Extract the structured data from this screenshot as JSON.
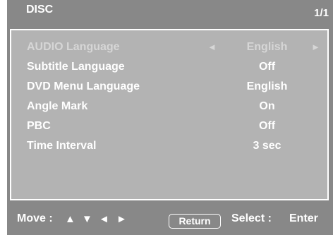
{
  "header": {
    "title": "DISC",
    "page": "1/1"
  },
  "menu": {
    "items": [
      {
        "label": "AUDIO Language",
        "value": "English",
        "selected": true
      },
      {
        "label": "Subtitle Language",
        "value": "Off"
      },
      {
        "label": "DVD Menu Language",
        "value": "English"
      },
      {
        "label": "Angle Mark",
        "value": "On"
      },
      {
        "label": "PBC",
        "value": "Off"
      },
      {
        "label": "Time Interval",
        "value": "3 sec"
      }
    ]
  },
  "footer": {
    "move_label": "Move :",
    "arrows": [
      "▲",
      "▼",
      "◄",
      "►"
    ],
    "return_label": "Return",
    "select_label": "Select :",
    "enter_label": "Enter"
  },
  "icons": {
    "left": "◄",
    "right": "►"
  },
  "colors": {
    "background": "#888888",
    "panel": "#b3b3b3",
    "text": "#ffffff",
    "selected_text": "#d6d6d6"
  }
}
